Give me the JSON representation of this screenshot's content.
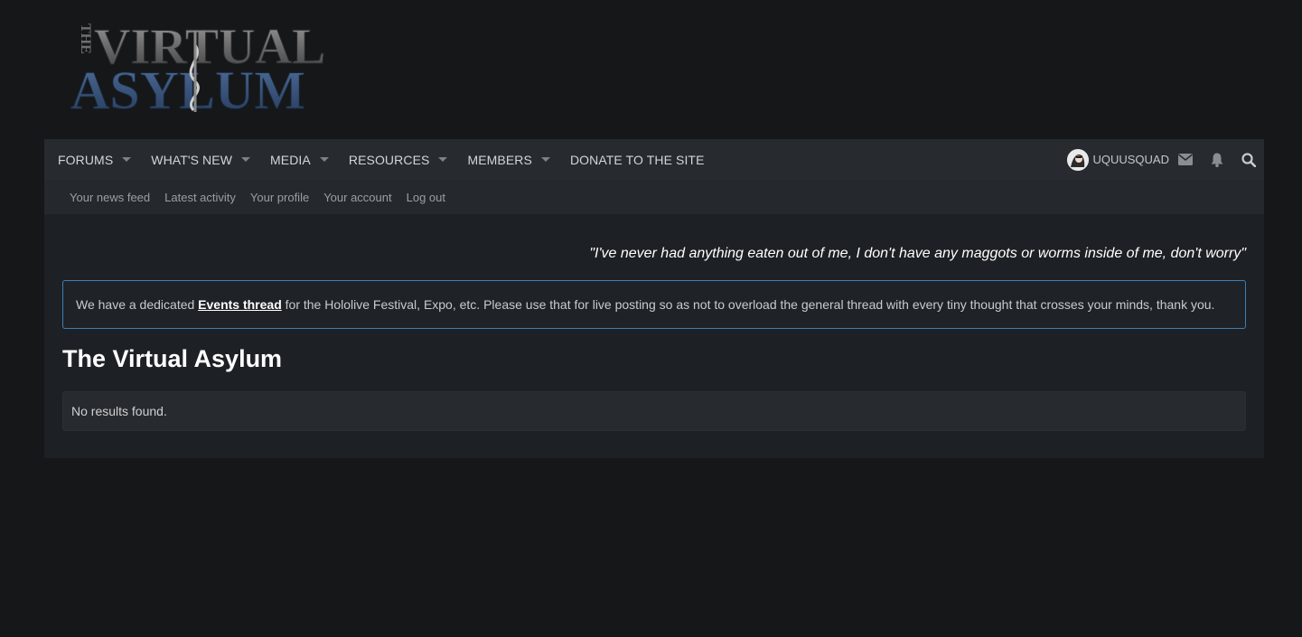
{
  "logo": {
    "line1_small": "THE",
    "line1": "VIRTUAL",
    "line2": "ASYLUM"
  },
  "nav": {
    "items": [
      {
        "label": "FORUMS",
        "has_menu": true
      },
      {
        "label": "WHAT'S NEW",
        "has_menu": true
      },
      {
        "label": "MEDIA",
        "has_menu": true
      },
      {
        "label": "RESOURCES",
        "has_menu": true
      },
      {
        "label": "MEMBERS",
        "has_menu": true
      },
      {
        "label": "DONATE TO THE SITE",
        "has_menu": false
      }
    ],
    "user": {
      "name": "UQUUSQUAD"
    },
    "icons": [
      "envelope-icon",
      "bell-icon",
      "search-icon"
    ]
  },
  "subnav": {
    "links": [
      "Your news feed",
      "Latest activity",
      "Your profile",
      "Your account",
      "Log out"
    ]
  },
  "quote": "\"I've never had anything eaten out of me, I don't have any maggots or worms inside of me, don't worry\"",
  "notice": {
    "before": "We have a dedicated ",
    "link": "Events thread",
    "after": " for the Hololive Festival, Expo, etc. Please use that for live posting so as not to overload the general thread with every tiny thought that crosses your minds, thank you."
  },
  "page_title": "The Virtual Asylum",
  "results_text": "No results found.",
  "colors": {
    "background": "#151719",
    "panel": "#1d2024",
    "nav": "#272b2f",
    "accent_border": "#3b7fb5"
  }
}
